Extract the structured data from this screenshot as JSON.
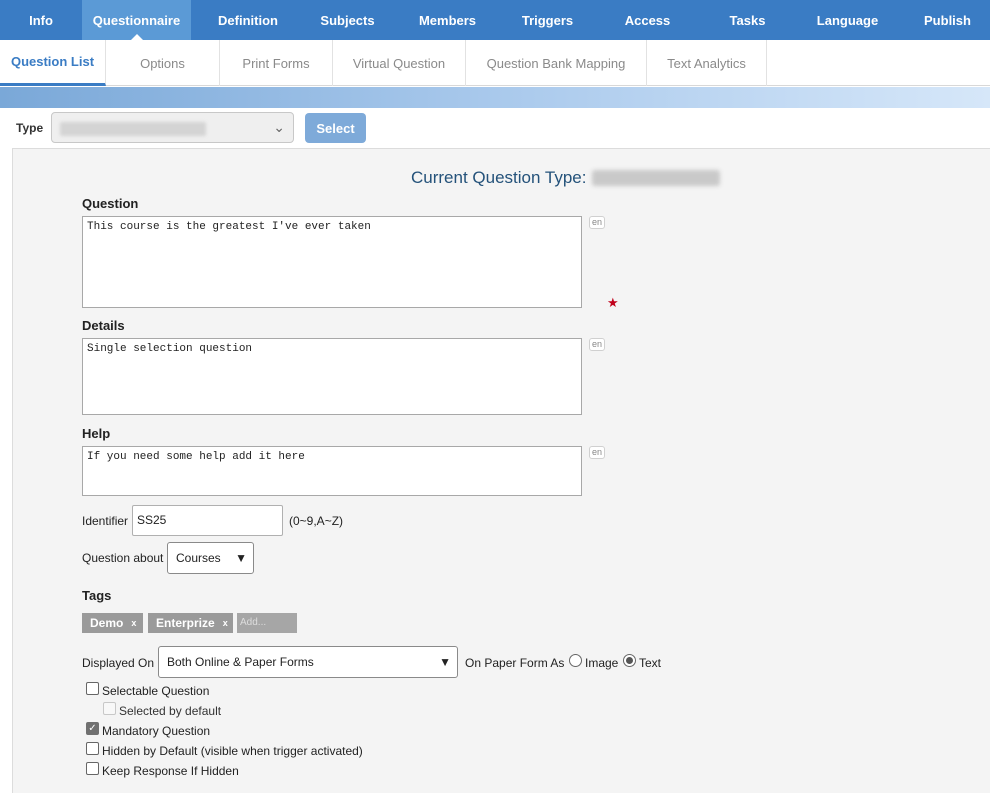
{
  "topnav": {
    "items": [
      {
        "label": "Info"
      },
      {
        "label": "Questionnaire"
      },
      {
        "label": "Definition"
      },
      {
        "label": "Subjects"
      },
      {
        "label": "Members"
      },
      {
        "label": "Triggers"
      },
      {
        "label": "Access"
      },
      {
        "label": "Tasks"
      },
      {
        "label": "Language"
      },
      {
        "label": "Publish"
      }
    ],
    "active": "Questionnaire"
  },
  "subtabs": {
    "items": [
      {
        "label": "Question List"
      },
      {
        "label": "Options"
      },
      {
        "label": "Print Forms"
      },
      {
        "label": "Virtual Question"
      },
      {
        "label": "Question Bank Mapping"
      },
      {
        "label": "Text Analytics"
      }
    ],
    "active": "Question List"
  },
  "type_row": {
    "label": "Type",
    "button": "Select"
  },
  "form": {
    "current_type_label": "Current Question Type:",
    "question_label": "Question",
    "question_value": "This course is the greatest I've ever taken",
    "details_label": "Details",
    "details_value": "Single selection question",
    "help_label": "Help",
    "help_value": "If you need some help add it here",
    "lang_tag": "en",
    "required_mark": "★",
    "identifier_label": "Identifier",
    "identifier_value": "SS25",
    "identifier_hint": "(0~9,A~Z)",
    "about_label": "Question about",
    "about_value": "Courses",
    "tags_label": "Tags",
    "tags": [
      {
        "label": "Demo"
      },
      {
        "label": "Enterprize"
      }
    ],
    "tag_remove": "x",
    "tag_add_placeholder": "Add...",
    "displayed_on_label": "Displayed On",
    "displayed_on_value": "Both Online & Paper Forms",
    "paper_form_label": "On Paper Form As",
    "paper_options": {
      "image": "Image",
      "text": "Text",
      "selected": "Text"
    },
    "checkboxes": {
      "selectable": {
        "label": "Selectable Question",
        "checked": false
      },
      "selected_default": {
        "label": "Selected by default",
        "checked": false,
        "disabled": true
      },
      "mandatory": {
        "label": "Mandatory Question",
        "checked": true
      },
      "hidden_default": {
        "label": "Hidden by Default (visible when trigger activated)",
        "checked": false
      },
      "keep_response": {
        "label": "Keep Response If Hidden",
        "checked": false
      }
    }
  }
}
